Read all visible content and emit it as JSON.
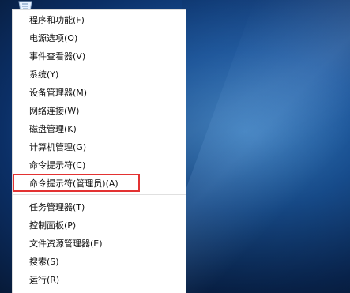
{
  "menu": {
    "items": [
      {
        "label": "程序和功能(F)",
        "name": "menu-item-programs-features"
      },
      {
        "label": "电源选项(O)",
        "name": "menu-item-power-options"
      },
      {
        "label": "事件查看器(V)",
        "name": "menu-item-event-viewer"
      },
      {
        "label": "系统(Y)",
        "name": "menu-item-system"
      },
      {
        "label": "设备管理器(M)",
        "name": "menu-item-device-manager"
      },
      {
        "label": "网络连接(W)",
        "name": "menu-item-network-connections"
      },
      {
        "label": "磁盘管理(K)",
        "name": "menu-item-disk-management"
      },
      {
        "label": "计算机管理(G)",
        "name": "menu-item-computer-management"
      },
      {
        "label": "命令提示符(C)",
        "name": "menu-item-command-prompt"
      },
      {
        "label": "命令提示符(管理员)(A)",
        "name": "menu-item-command-prompt-admin",
        "selected": true
      },
      {
        "label": "任务管理器(T)",
        "name": "menu-item-task-manager"
      },
      {
        "label": "控制面板(P)",
        "name": "menu-item-control-panel"
      },
      {
        "label": "文件资源管理器(E)",
        "name": "menu-item-file-explorer"
      },
      {
        "label": "搜索(S)",
        "name": "menu-item-search"
      },
      {
        "label": "运行(R)",
        "name": "menu-item-run"
      }
    ]
  },
  "accent": {
    "highlight_border": "#e33232",
    "wallpaper_primary": "#1b5aa6"
  },
  "icons": {
    "corner": "recycle-bin-icon"
  }
}
